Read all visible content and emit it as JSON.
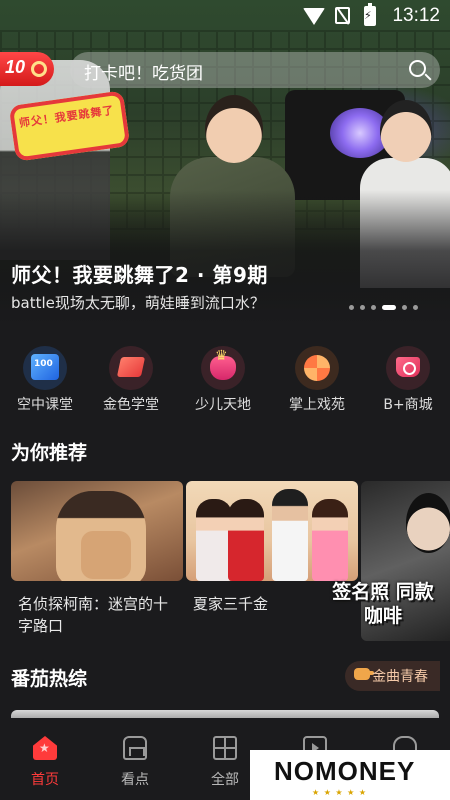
{
  "status_bar": {
    "time": "13:12"
  },
  "app": {
    "logo_text": "10"
  },
  "search": {
    "placeholder": "打卡吧！吃货团"
  },
  "hero": {
    "show_logo": "师父！我要跳舞了",
    "title": "师父！我要跳舞了2 · 第9期",
    "subtitle": "battle现场太无聊，萌娃睡到流口水？",
    "dot_count": 6,
    "active_dot": 3
  },
  "entries": [
    {
      "label": "空中课堂",
      "icon": "classroom-icon"
    },
    {
      "label": "金色学堂",
      "icon": "gold-academy-icon"
    },
    {
      "label": "少儿天地",
      "icon": "kids-icon"
    },
    {
      "label": "掌上戏苑",
      "icon": "opera-icon"
    },
    {
      "label": "B+商城",
      "icon": "shopping-cart-icon"
    }
  ],
  "recommend": {
    "title": "为你推荐",
    "cards": [
      {
        "title": "名侦探柯南：迷宫的十字路口"
      },
      {
        "title": "夏家三千金"
      },
      {
        "title": "",
        "promo": "签名照 同款咖啡"
      }
    ]
  },
  "variety": {
    "title": "番茄热综",
    "badge": "金曲青春"
  },
  "bottom_nav": [
    {
      "label": "首页",
      "icon": "home-icon",
      "active": true
    },
    {
      "label": "看点",
      "icon": "sofa-icon",
      "active": false
    },
    {
      "label": "全部",
      "icon": "grid-icon",
      "active": false
    },
    {
      "label": "",
      "icon": "tv-icon",
      "active": false
    },
    {
      "label": "",
      "icon": "profile-icon",
      "active": false
    }
  ],
  "watermark": {
    "text": "NOMONEY"
  },
  "colors": {
    "accent": "#ff3b3b",
    "background": "#1b1b1d"
  }
}
